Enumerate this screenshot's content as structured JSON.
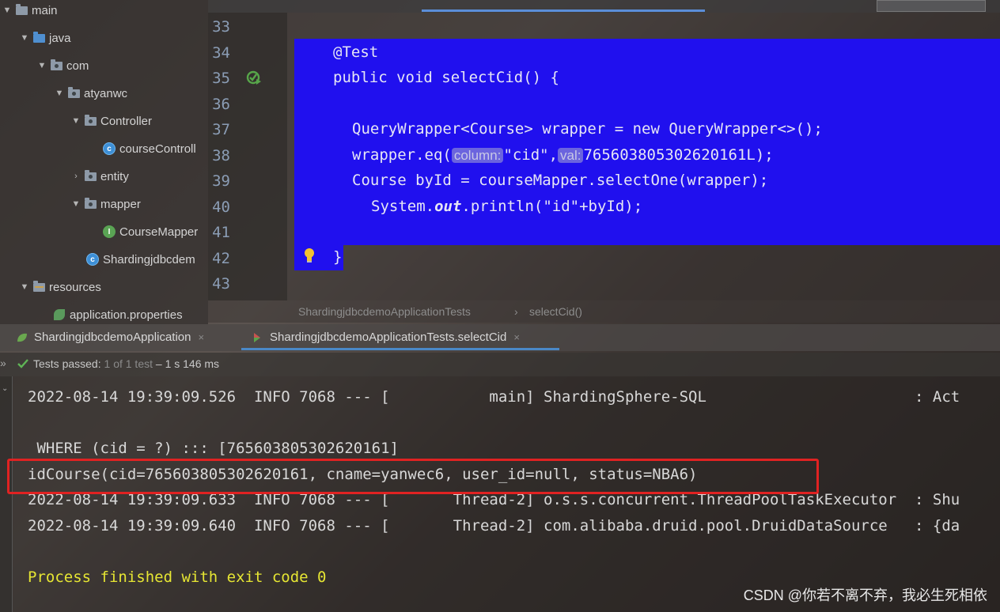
{
  "project_tree": {
    "items": [
      {
        "label": "main",
        "depth": 0,
        "expanded": true,
        "icon": "folder-icon"
      },
      {
        "label": "java",
        "depth": 1,
        "expanded": true,
        "icon": "source-folder-icon"
      },
      {
        "label": "com",
        "depth": 2,
        "expanded": true,
        "icon": "package-icon"
      },
      {
        "label": "atyanwc",
        "depth": 3,
        "expanded": true,
        "icon": "package-icon"
      },
      {
        "label": "Controller",
        "depth": 4,
        "expanded": true,
        "icon": "package-icon"
      },
      {
        "label": "courseControll",
        "depth": 5,
        "icon": "class-icon"
      },
      {
        "label": "entity",
        "depth": 4,
        "expanded": false,
        "icon": "package-icon"
      },
      {
        "label": "mapper",
        "depth": 4,
        "expanded": true,
        "icon": "package-icon"
      },
      {
        "label": "CourseMapper",
        "depth": 5,
        "icon": "interface-icon"
      },
      {
        "label": "Shardingjdbcdem",
        "depth": 4,
        "icon": "spring-class-icon"
      },
      {
        "label": "resources",
        "depth": 1,
        "expanded": true,
        "icon": "resources-folder-icon"
      },
      {
        "label": "application.properties",
        "depth": 2,
        "icon": "properties-file-icon"
      }
    ]
  },
  "editor": {
    "line_numbers": [
      "33",
      "34",
      "35",
      "36",
      "37",
      "38",
      "39",
      "40",
      "41",
      "42",
      "43"
    ],
    "code": {
      "l34": "@Test",
      "l35": "public void selectCid() {",
      "l37": "QueryWrapper<Course> wrapper = new QueryWrapper<>();",
      "l38_a": "wrapper.eq(",
      "l38_hint1": "column:",
      "l38_b": "\"cid\",",
      "l38_hint2": "val:",
      "l38_c": "765603805302620161L);",
      "l39": "Course byId = courseMapper.selectOne(wrapper);",
      "l40_a": "System.",
      "l40_b": "out",
      "l40_c": ".println(\"id\"+byId);",
      "l42": "}"
    },
    "selection_color": "#2010ee"
  },
  "breadcrumb": {
    "class": "ShardingjdbcdemoApplicationTests",
    "separator": "›",
    "method": "selectCid()"
  },
  "run_tabs": [
    {
      "label": "ShardingjdbcdemoApplication",
      "close": "×"
    },
    {
      "label": "ShardingjdbcdemoApplicationTests.selectCid",
      "close": "×",
      "active": true
    }
  ],
  "status": {
    "chevrons": "»",
    "passed": "Tests passed:",
    "count_a": "1",
    "count_b": "of 1 test",
    "duration": "– 1 s 146 ms"
  },
  "console": {
    "lines": [
      "2022-08-14 19:39:09.526  INFO 7068 --- [           main] ShardingSphere-SQL                       : Act",
      " WHERE (cid = ?) ::: [765603805302620161]",
      "idCourse(cid=765603805302620161, cname=yanwec6, user_id=null, status=NBA6)",
      "2022-08-14 19:39:09.633  INFO 7068 --- [       Thread-2] o.s.s.concurrent.ThreadPoolTaskExecutor  : Shu",
      "2022-08-14 19:39:09.640  INFO 7068 --- [       Thread-2] com.alibaba.druid.pool.DruidDataSource   : {da",
      "Process finished with exit code 0"
    ]
  },
  "watermark": "CSDN @你若不离不弃，我必生死相依"
}
